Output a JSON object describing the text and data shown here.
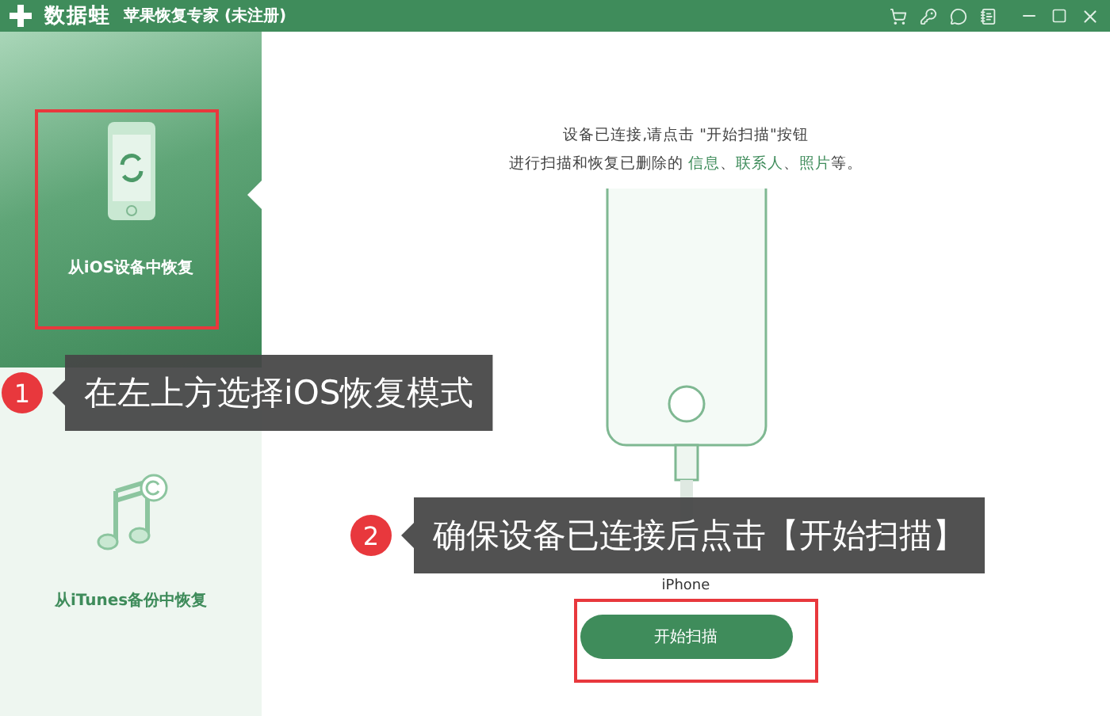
{
  "window": {
    "logo": "数据蛙",
    "title": "苹果恢复专家 (未注册)"
  },
  "sidebar": {
    "items": [
      {
        "label": "从iOS设备中恢复",
        "selected": true,
        "kind": "phone"
      },
      {
        "label": "从iTunes备份中恢复",
        "selected": false,
        "kind": "music"
      }
    ]
  },
  "main": {
    "line_1": "设备已连接,请点击 \"开始扫描\"按钮",
    "line_2": [
      {
        "text": "进行扫描和恢复已删除的 ",
        "highlight": false
      },
      {
        "text": "信息",
        "highlight": true
      },
      {
        "text": "、",
        "highlight": false
      },
      {
        "text": "联系人",
        "highlight": true
      },
      {
        "text": "、",
        "highlight": false
      },
      {
        "text": "照片",
        "highlight": true
      },
      {
        "text": "等。",
        "highlight": false
      }
    ],
    "device_name": "iPhone",
    "button": "开始扫描"
  },
  "annotations": [
    {
      "number": "1",
      "text": "在左上方选择iOS恢复模式"
    },
    {
      "number": "2",
      "text": "确保设备已连接后点击【开始扫描】"
    }
  ]
}
